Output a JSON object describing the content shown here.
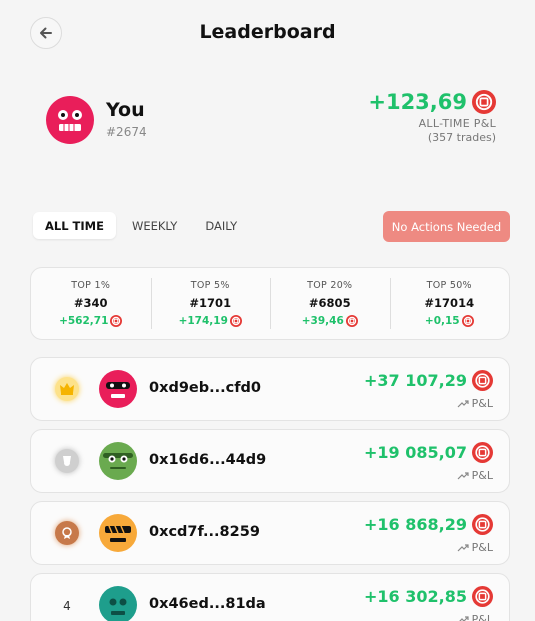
{
  "header": {
    "title": "Leaderboard",
    "back_icon": "arrow-left-icon"
  },
  "user": {
    "name": "You",
    "rank": "#2674",
    "pnl": "+123,69",
    "pnl_label": "ALL-TIME P&L",
    "trades": "(357 trades)",
    "avatar_color": "#e91e5a"
  },
  "tabs": [
    {
      "label": "ALL TIME",
      "active": true
    },
    {
      "label": "WEEKLY",
      "active": false
    },
    {
      "label": "DAILY",
      "active": false
    }
  ],
  "status_button": {
    "label": "No Actions Needed",
    "color": "#ee8a82"
  },
  "tiers": [
    {
      "label": "TOP 1%",
      "rank": "#340",
      "pnl": "+562,71"
    },
    {
      "label": "TOP 5%",
      "rank": "#1701",
      "pnl": "+174,19"
    },
    {
      "label": "TOP 20%",
      "rank": "#6805",
      "pnl": "+39,46"
    },
    {
      "label": "TOP 50%",
      "rank": "#17014",
      "pnl": "+0,15"
    }
  ],
  "rows": [
    {
      "rank": "1",
      "address": "0xd9eb...cfd0",
      "pnl": "+37 107,29",
      "sub": "P&L",
      "medal": "gold"
    },
    {
      "rank": "2",
      "address": "0x16d6...44d9",
      "pnl": "+19 085,07",
      "sub": "P&L",
      "medal": "silver"
    },
    {
      "rank": "3",
      "address": "0xcd7f...8259",
      "pnl": "+16 868,29",
      "sub": "P&L",
      "medal": "bronze"
    },
    {
      "rank": "4",
      "address": "0x46ed...81da",
      "pnl": "+16 302,85",
      "sub": "P&L",
      "medal": ""
    }
  ],
  "colors": {
    "accent_green": "#1fc16b",
    "token_red": "#e53935"
  }
}
